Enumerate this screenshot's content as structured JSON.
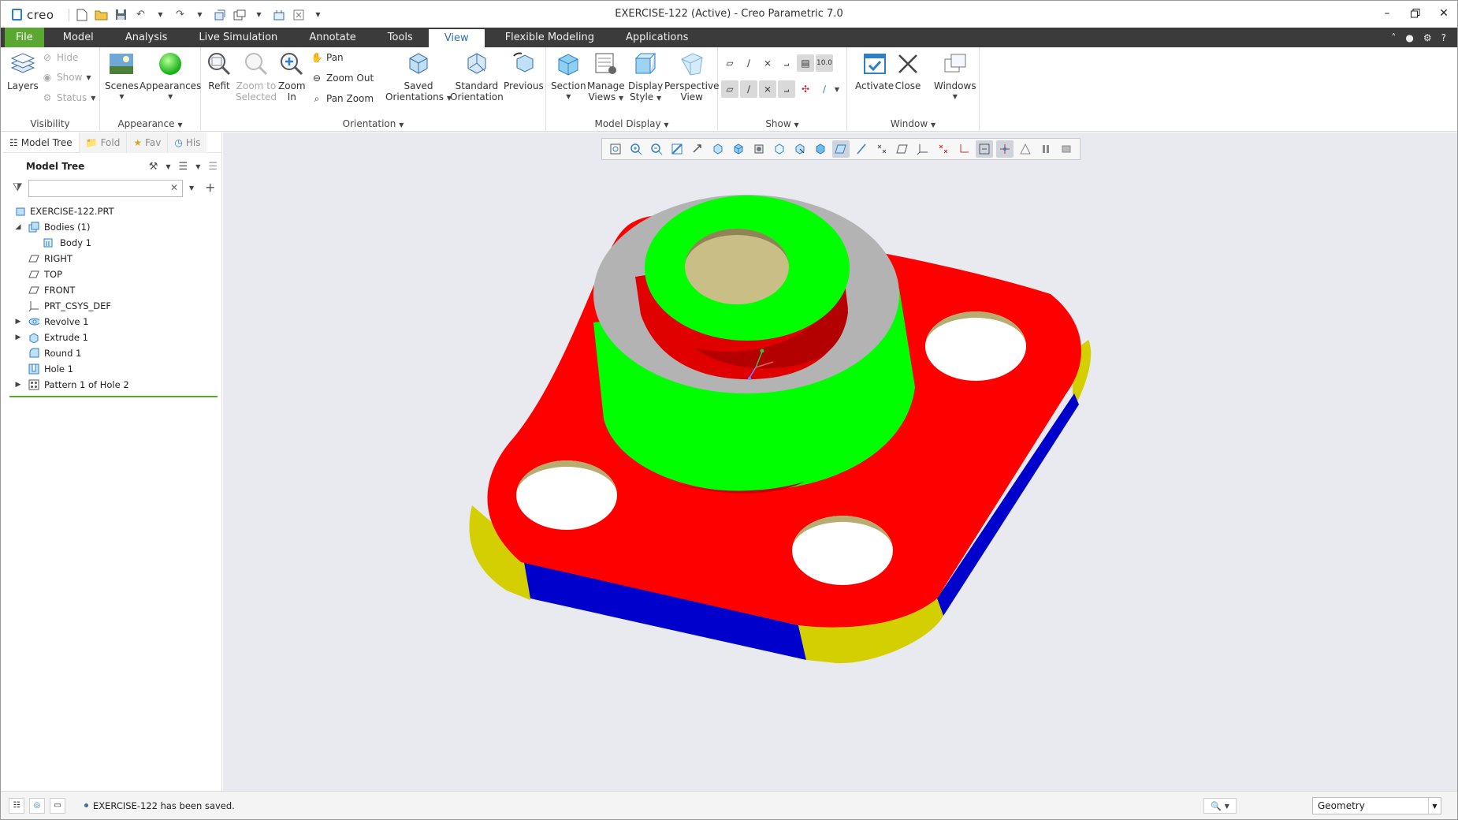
{
  "app": {
    "logo_text": "creo",
    "window_title": "EXERCISE-122 (Active) - Creo Parametric 7.0"
  },
  "tabs": [
    {
      "label": "File"
    },
    {
      "label": "Model"
    },
    {
      "label": "Analysis"
    },
    {
      "label": "Live Simulation"
    },
    {
      "label": "Annotate"
    },
    {
      "label": "Tools"
    },
    {
      "label": "View"
    },
    {
      "label": "Flexible Modeling"
    },
    {
      "label": "Applications"
    }
  ],
  "ribbon": {
    "visibility": {
      "group_label": "Visibility",
      "layers": "Layers",
      "hide": "Hide",
      "show": "Show",
      "status": "Status"
    },
    "appearance": {
      "group_label": "Appearance",
      "scenes": "Scenes",
      "appearances": "Appearances"
    },
    "orientation": {
      "group_label": "Orientation",
      "refit": "Refit",
      "zoom_to_selected_1": "Zoom to",
      "zoom_to_selected_2": "Selected",
      "zoom_in_1": "Zoom",
      "zoom_in_2": "In",
      "pan": "Pan",
      "zoom_out": "Zoom Out",
      "pan_zoom": "Pan Zoom",
      "saved_orientations_1": "Saved",
      "saved_orientations_2": "Orientations",
      "standard_orientation_1": "Standard",
      "standard_orientation_2": "Orientation",
      "previous": "Previous"
    },
    "model_display": {
      "group_label": "Model Display",
      "section": "Section",
      "manage_views_1": "Manage",
      "manage_views_2": "Views",
      "display_style_1": "Display",
      "display_style_2": "Style",
      "perspective_view_1": "Perspective",
      "perspective_view_2": "View"
    },
    "show": {
      "group_label": "Show"
    },
    "window": {
      "group_label": "Window",
      "activate": "Activate",
      "close": "Close",
      "windows": "Windows"
    }
  },
  "left_panel": {
    "tabs": [
      {
        "label": "Model Tree"
      },
      {
        "label": "Fold"
      },
      {
        "label": "Fav"
      },
      {
        "label": "His"
      }
    ],
    "tree_title": "Model Tree",
    "search_value": "",
    "items": [
      {
        "label": "EXERCISE-122.PRT",
        "icon": "part-icon"
      },
      {
        "label": "Bodies (1)",
        "icon": "bodies-icon"
      },
      {
        "label": "Body 1",
        "icon": "body-icon"
      },
      {
        "label": "RIGHT",
        "icon": "datum-plane-icon"
      },
      {
        "label": "TOP",
        "icon": "datum-plane-icon"
      },
      {
        "label": "FRONT",
        "icon": "datum-plane-icon"
      },
      {
        "label": "PRT_CSYS_DEF",
        "icon": "csys-icon"
      },
      {
        "label": "Revolve 1",
        "icon": "revolve-icon"
      },
      {
        "label": "Extrude 1",
        "icon": "extrude-icon"
      },
      {
        "label": "Round 1",
        "icon": "round-icon"
      },
      {
        "label": "Hole 1",
        "icon": "hole-icon"
      },
      {
        "label": "Pattern 1 of Hole 2",
        "icon": "pattern-icon"
      }
    ]
  },
  "status": {
    "message": "EXERCISE-122 has been saved.",
    "filter_value": "Geometry"
  },
  "colors": {
    "face_top": "#ff0000",
    "face_green": "#00ff00",
    "face_gray": "#b3b3b3",
    "face_blue": "#0000cc",
    "face_yellow": "#d4cf00",
    "hole_wall": "#b8ad70",
    "accent_green": "#5aa832",
    "tab_bar": "#3b3b3b"
  }
}
